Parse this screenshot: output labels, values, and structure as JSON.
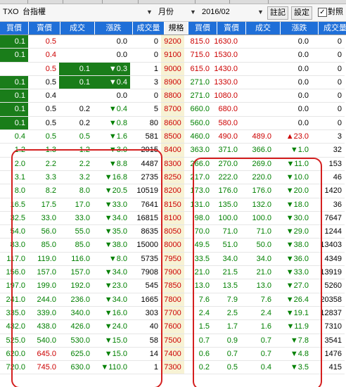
{
  "toolbar": {
    "symbol": "TXO",
    "symbol_name": "台指權",
    "period": "月份",
    "month": "2016/02",
    "note_label": "註記",
    "settings_label": "設定",
    "pair_checked_mark": "✓",
    "pair_label": "對照"
  },
  "colors": {
    "header_bg": "#1f6fd8",
    "strike_bg": "#f7f2d4",
    "up": "#cc0000",
    "down": "#008000",
    "highlight_box": "#d41f1f",
    "bid_cell_bg": "#1a7d1a"
  },
  "headers": [
    "買價",
    "賣價",
    "成交",
    "漲跌",
    "成交量",
    "規格",
    "買價",
    "賣價",
    "成交",
    "漲跌",
    "成交量"
  ],
  "rows": [
    {
      "strike": "9200",
      "call": [
        "0.1",
        "0.5",
        "",
        "0.0",
        "0"
      ],
      "put": [
        "815.0",
        "1630.0",
        "",
        "0.0",
        "0"
      ],
      "call_bid_bg": true,
      "call_ask_red": true,
      "put_bid_red": true,
      "put_ask_red": true,
      "call_last_bg": false
    },
    {
      "strike": "9100",
      "call": [
        "0.1",
        "0.4",
        "",
        "0.0",
        "0"
      ],
      "put": [
        "715.0",
        "1530.0",
        "",
        "0.0",
        "0"
      ],
      "call_bid_bg": true,
      "call_ask_red": true,
      "put_bid_red": true,
      "put_ask_red": true
    },
    {
      "strike": "9000",
      "call": [
        "",
        "0.5",
        "0.1",
        "▼0.3",
        "1"
      ],
      "put": [
        "615.0",
        "1430.0",
        "",
        "0.0",
        "0"
      ],
      "call_ask_red": true,
      "call_last_bg": true,
      "call_chg_bg": true,
      "put_bid_red": true,
      "put_ask_red": true
    },
    {
      "strike": "8900",
      "call": [
        "0.1",
        "0.5",
        "0.1",
        "▼0.4",
        "3"
      ],
      "put": [
        "271.0",
        "1330.0",
        "",
        "0.0",
        "0"
      ],
      "call_bid_bg": true,
      "call_last_bg": true,
      "call_chg_bg": true,
      "put_bid_grn": true,
      "put_ask_red": true
    },
    {
      "strike": "8800",
      "call": [
        "0.1",
        "0.4",
        "",
        "0.0",
        "0"
      ],
      "put": [
        "271.0",
        "1080.0",
        "",
        "0.0",
        "0"
      ],
      "call_bid_bg": true,
      "put_bid_grn": true,
      "put_ask_red": true
    },
    {
      "strike": "8700",
      "call": [
        "0.1",
        "0.5",
        "0.2",
        "▼0.4",
        "5"
      ],
      "put": [
        "660.0",
        "680.0",
        "",
        "0.0",
        "0"
      ],
      "call_bid_bg": true,
      "put_bid_grn": true,
      "put_ask_red": true
    },
    {
      "strike": "8600",
      "call": [
        "0.1",
        "0.5",
        "0.2",
        "▼0.8",
        "80"
      ],
      "put": [
        "560.0",
        "580.0",
        "",
        "0.0",
        "0"
      ],
      "call_bid_bg": true,
      "put_bid_grn": true,
      "put_ask_red": true
    },
    {
      "strike": "8500",
      "call": [
        "0.4",
        "0.5",
        "0.5",
        "▼1.6",
        "581"
      ],
      "put": [
        "460.0",
        "490.0",
        "489.0",
        "▲23.0",
        "3"
      ],
      "put_bid_grn": true,
      "put_ask_red": true,
      "put_last_red": true,
      "put_chg_red": true
    },
    {
      "strike": "8400",
      "call": [
        "1.2",
        "1.3",
        "1.2",
        "▼3.0",
        "2915"
      ],
      "put": [
        "363.0",
        "371.0",
        "366.0",
        "▼1.0",
        "32"
      ]
    },
    {
      "strike": "8300",
      "call": [
        "2.0",
        "2.2",
        "2.2",
        "▼8.8",
        "4487"
      ],
      "put": [
        "266.0",
        "270.0",
        "269.0",
        "▼11.0",
        "153"
      ]
    },
    {
      "strike": "8250",
      "call": [
        "3.1",
        "3.3",
        "3.2",
        "▼16.8",
        "2735"
      ],
      "put": [
        "217.0",
        "222.0",
        "220.0",
        "▼10.0",
        "46"
      ]
    },
    {
      "strike": "8200",
      "call": [
        "8.0",
        "8.2",
        "8.0",
        "▼20.5",
        "10519"
      ],
      "put": [
        "173.0",
        "176.0",
        "176.0",
        "▼20.0",
        "1420"
      ]
    },
    {
      "strike": "8150",
      "call": [
        "16.5",
        "17.5",
        "17.0",
        "▼33.0",
        "7641"
      ],
      "put": [
        "131.0",
        "135.0",
        "132.0",
        "▼18.0",
        "36"
      ]
    },
    {
      "strike": "8100",
      "call": [
        "32.5",
        "33.0",
        "33.0",
        "▼34.0",
        "16815"
      ],
      "put": [
        "98.0",
        "100.0",
        "100.0",
        "▼30.0",
        "7647"
      ]
    },
    {
      "strike": "8050",
      "call": [
        "54.0",
        "56.0",
        "55.0",
        "▼35.0",
        "8635"
      ],
      "put": [
        "70.0",
        "71.0",
        "71.0",
        "▼29.0",
        "1244"
      ]
    },
    {
      "strike": "8000",
      "call": [
        "83.0",
        "85.0",
        "85.0",
        "▼38.0",
        "15000"
      ],
      "put": [
        "49.5",
        "51.0",
        "50.0",
        "▼38.0",
        "13403"
      ]
    },
    {
      "strike": "7950",
      "call": [
        "117.0",
        "119.0",
        "116.0",
        "▼8.0",
        "5735"
      ],
      "put": [
        "33.5",
        "34.0",
        "34.0",
        "▼36.0",
        "4349"
      ]
    },
    {
      "strike": "7900",
      "call": [
        "156.0",
        "157.0",
        "157.0",
        "▼34.0",
        "7908"
      ],
      "put": [
        "21.0",
        "21.5",
        "21.0",
        "▼33.0",
        "13919"
      ]
    },
    {
      "strike": "7850",
      "call": [
        "197.0",
        "199.0",
        "192.0",
        "▼23.0",
        "545"
      ],
      "put": [
        "13.0",
        "13.5",
        "13.0",
        "▼27.0",
        "5260"
      ]
    },
    {
      "strike": "7800",
      "call": [
        "241.0",
        "244.0",
        "236.0",
        "▼34.0",
        "1665"
      ],
      "put": [
        "7.6",
        "7.9",
        "7.6",
        "▼26.4",
        "20358"
      ]
    },
    {
      "strike": "7700",
      "call": [
        "335.0",
        "339.0",
        "340.0",
        "▼16.0",
        "303"
      ],
      "put": [
        "2.4",
        "2.5",
        "2.4",
        "▼19.1",
        "12837"
      ]
    },
    {
      "strike": "7600",
      "call": [
        "432.0",
        "438.0",
        "426.0",
        "▼24.0",
        "40"
      ],
      "put": [
        "1.5",
        "1.7",
        "1.6",
        "▼11.9",
        "7310"
      ]
    },
    {
      "strike": "7500",
      "call": [
        "525.0",
        "540.0",
        "530.0",
        "▼15.0",
        "58"
      ],
      "put": [
        "0.7",
        "0.9",
        "0.7",
        "▼7.8",
        "3541"
      ]
    },
    {
      "strike": "7400",
      "call": [
        "620.0",
        "645.0",
        "625.0",
        "▼15.0",
        "14"
      ],
      "put": [
        "0.6",
        "0.7",
        "0.7",
        "▼4.8",
        "1476"
      ],
      "call_ask_red": true
    },
    {
      "strike": "7300",
      "call": [
        "720.0",
        "745.0",
        "630.0",
        "▼110.0",
        "1"
      ],
      "put": [
        "0.2",
        "0.5",
        "0.4",
        "▼3.5",
        "415"
      ],
      "call_ask_red": true
    }
  ]
}
